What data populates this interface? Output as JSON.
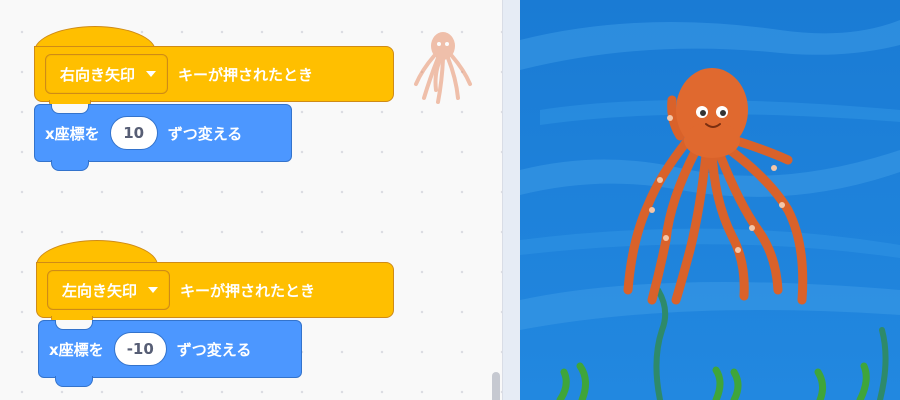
{
  "script1": {
    "event_key": "右向き矢印",
    "event_suffix": "キーが押されたとき",
    "motion_prefix": "x座標を",
    "motion_value": "10",
    "motion_suffix": "ずつ変える"
  },
  "script2": {
    "event_key": "左向き矢印",
    "event_suffix": "キーが押されたとき",
    "motion_prefix": "x座標を",
    "motion_value": "-10",
    "motion_suffix": "ずつ変える"
  },
  "colors": {
    "events_block": "#ffbf00",
    "events_border": "#cf8b17",
    "motion_block": "#4c97ff",
    "motion_border": "#3373cc",
    "stage_water": "#1f7fd6",
    "octopus": "#e0692f"
  },
  "icons": {
    "dropdown": "caret-down-icon",
    "sprite": "octopus-sprite-icon"
  }
}
